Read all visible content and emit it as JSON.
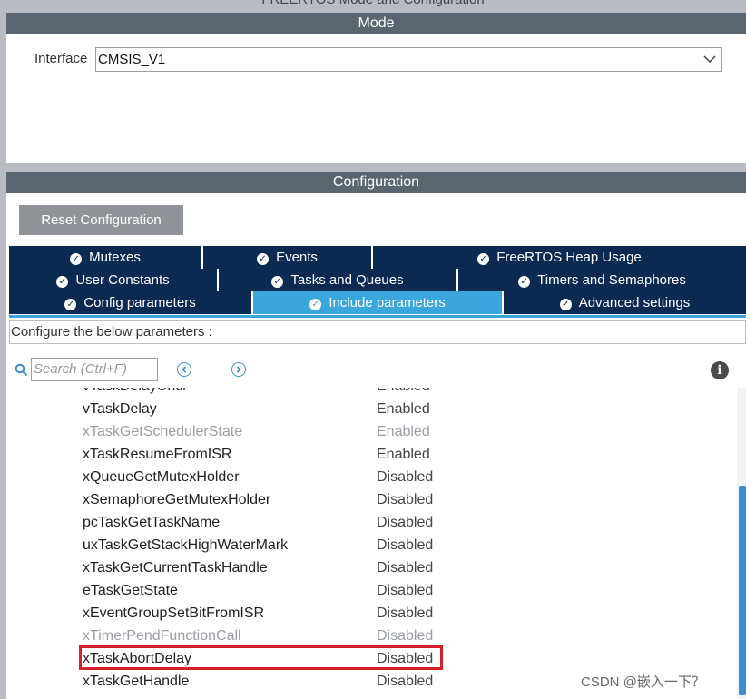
{
  "top_caption": "FREERTOS Mode and Configuration",
  "mode": {
    "header": "Mode",
    "interface_label": "Interface",
    "interface_value": "CMSIS_V1"
  },
  "configuration": {
    "header": "Configuration",
    "reset_label": "Reset Configuration",
    "tabs_row1": [
      "Mutexes",
      "Events",
      "FreeRTOS Heap Usage"
    ],
    "tabs_row2": [
      "User Constants",
      "Tasks and Queues",
      "Timers and Semaphores"
    ],
    "tabs_row3": [
      "Config parameters",
      "Include parameters",
      "Advanced settings"
    ],
    "active_tab": "Include parameters",
    "configure_text": "Configure the below parameters :",
    "search_placeholder": "Search (Ctrl+F)",
    "accent_color": "#3ba6dc",
    "tab_color": "#0a2a52",
    "highlight_color": "#d8202a"
  },
  "parameters": [
    {
      "name": "vTaskDelayUntil",
      "value": "Enabled",
      "dim": false
    },
    {
      "name": "vTaskDelay",
      "value": "Enabled",
      "dim": false
    },
    {
      "name": "xTaskGetSchedulerState",
      "value": "Enabled",
      "dim": true
    },
    {
      "name": "xTaskResumeFromISR",
      "value": "Enabled",
      "dim": false
    },
    {
      "name": "xQueueGetMutexHolder",
      "value": "Disabled",
      "dim": false
    },
    {
      "name": "xSemaphoreGetMutexHolder",
      "value": "Disabled",
      "dim": false
    },
    {
      "name": "pcTaskGetTaskName",
      "value": "Disabled",
      "dim": false
    },
    {
      "name": "uxTaskGetStackHighWaterMark",
      "value": "Disabled",
      "dim": false
    },
    {
      "name": "xTaskGetCurrentTaskHandle",
      "value": "Disabled",
      "dim": false
    },
    {
      "name": "eTaskGetState",
      "value": "Disabled",
      "dim": false
    },
    {
      "name": "xEventGroupSetBitFromISR",
      "value": "Disabled",
      "dim": false
    },
    {
      "name": "xTimerPendFunctionCall",
      "value": "Disabled",
      "dim": true
    },
    {
      "name": "xTaskAbortDelay",
      "value": "Disabled",
      "dim": false
    },
    {
      "name": "xTaskGetHandle",
      "value": "Disabled",
      "dim": false
    }
  ],
  "watermark": "CSDN @嵌入一下？"
}
